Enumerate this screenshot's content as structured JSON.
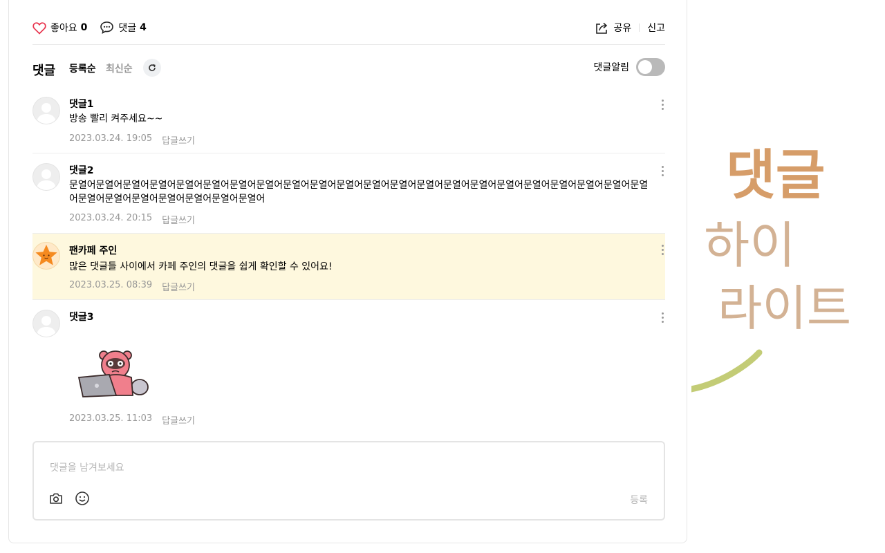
{
  "actions": {
    "like_label": "좋아요",
    "like_count": "0",
    "comment_label": "댓글",
    "comment_count": "4",
    "share_label": "공유",
    "report_label": "신고"
  },
  "comments_header": {
    "title": "댓글",
    "sort_registered": "등록순",
    "sort_latest": "최신순",
    "notify_label": "댓글알림",
    "notify_on": false
  },
  "comments": [
    {
      "nickname": "댓글1",
      "text": "방송 빨리 켜주세요~~",
      "date": "2023.03.24. 19:05",
      "reply_label": "답글쓰기"
    },
    {
      "nickname": "댓글2",
      "text": "문열어문열어문열어문열어문열어문열어문열어문열어문열어문열어문열어문열어문열어문열어문열어문열어문열어문열어문열어문열어문열어문열어문열어문열어문열어문열어문열어문열어문열어",
      "date": "2023.03.24. 20:15",
      "reply_label": "답글쓰기"
    },
    {
      "nickname": "팬카페 주인",
      "text": "많은 댓글들 사이에서 카페 주인의 댓글을 쉽게 확인할 수 있어요!",
      "date": "2023.03.25. 08:39",
      "reply_label": "답글쓰기",
      "highlight": true
    },
    {
      "nickname": "댓글3",
      "text": "",
      "date": "2023.03.25. 11:03",
      "reply_label": "답글쓰기",
      "sticker": "raccoon-laptop-sticker"
    }
  ],
  "editor": {
    "placeholder": "댓글을 남겨보세요",
    "submit_label": "등록"
  },
  "annotation": {
    "line1": "댓글",
    "line2": "하이",
    "line3": "라이트"
  },
  "colors": {
    "highlight_bg": "#fef8de",
    "like_heart": "#e8344e",
    "annotation_text": "#cf8c4f",
    "annotation_arrow": "#c3cc76"
  }
}
